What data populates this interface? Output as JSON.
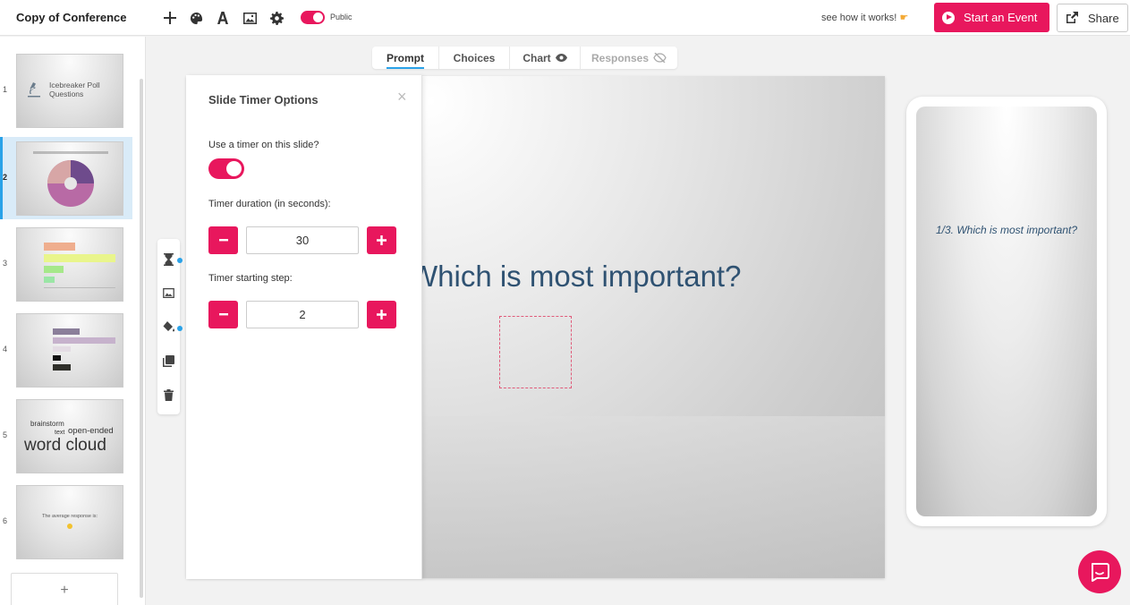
{
  "header": {
    "doc_title": "Copy of Conference",
    "public_label": "Public",
    "how_it_works": "see how it works!",
    "start_event_label": "Start an Event",
    "share_label": "Share"
  },
  "tabs": [
    {
      "label": "Prompt",
      "active": true
    },
    {
      "label": "Choices"
    },
    {
      "label": "Chart"
    },
    {
      "label": "Responses",
      "disabled": true
    }
  ],
  "slides": [
    {
      "number": "1",
      "thumb_title": "Icebreaker Poll Questions"
    },
    {
      "number": "2",
      "active": true
    },
    {
      "number": "3"
    },
    {
      "number": "4"
    },
    {
      "number": "5",
      "words": [
        "brainstorm",
        "open-ended",
        "text",
        "word cloud"
      ]
    },
    {
      "number": "6",
      "thumb_text": "The average response is:"
    }
  ],
  "add_slide_label": "+",
  "timer_panel": {
    "title": "Slide Timer Options",
    "close_label": "×",
    "use_timer_label": "Use a timer on this slide?",
    "use_timer_on": true,
    "duration_label": "Timer duration (in seconds):",
    "duration_value": "30",
    "start_step_label": "Timer starting step:",
    "start_step_value": "2"
  },
  "canvas": {
    "question": "Which is most important?"
  },
  "preview": {
    "question": "1/3. Which is most important?"
  },
  "colors": {
    "accent": "#e8175d",
    "highlight": "#2aa2e8",
    "question_text": "#2f5272"
  },
  "icons": [
    "add-icon",
    "palette-icon",
    "font-icon",
    "image-icon",
    "gear-icon",
    "play-icon",
    "share-icon",
    "eye-icon",
    "eye-slash-icon",
    "hourglass-icon",
    "paint-bucket-icon",
    "copy-icon",
    "trash-icon",
    "chat-icon"
  ]
}
